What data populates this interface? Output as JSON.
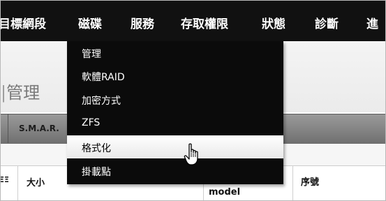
{
  "nav": {
    "items": [
      "目標網段",
      "磁碟",
      "服務",
      "存取權限",
      "狀態",
      "診斷",
      "進"
    ]
  },
  "page": {
    "title_bar": "|",
    "title": "管理"
  },
  "subtab": {
    "label": "S.M.A.R."
  },
  "table": {
    "headers": [
      "大小",
      "model",
      "序號"
    ],
    "edge_fragment": "ΞΞ"
  },
  "dropdown": {
    "items": [
      "管理",
      "軟體RAID",
      "加密方式",
      "ZFS",
      "格式化",
      "掛載點"
    ],
    "highlighted": "格式化"
  },
  "colors": {
    "nav_background": "#111111",
    "dropdown_background": "#0b0b0b",
    "highlight_background": "#f2f2f2"
  },
  "icons": {
    "cursor": "hand-pointer-icon"
  }
}
